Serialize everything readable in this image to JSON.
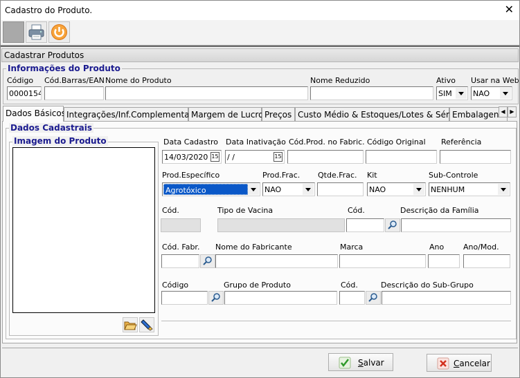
{
  "window": {
    "title": "Cadastro do Produto."
  },
  "header": {
    "title": "Cadastrar Produtos"
  },
  "info": {
    "legend": "Informações do Produto",
    "codigo_label": "Código",
    "codigo_value": "0000154",
    "barras_label": "Cód.Barras/EAN",
    "barras_value": "",
    "nome_label": "Nome do Produto",
    "nome_value": "",
    "reduzido_label": "Nome Reduzido",
    "reduzido_value": "",
    "ativo_label": "Ativo",
    "ativo_value": "SIM",
    "web_label": "Usar na Web",
    "web_value": "NAO"
  },
  "tabs": [
    {
      "label": "Dados Básicos"
    },
    {
      "label": "Integrações/Inf.Complementar"
    },
    {
      "label": "Margem de Lucro"
    },
    {
      "label": "Preços"
    },
    {
      "label": "Custo Médio & Estoques/Lotes & Série"
    },
    {
      "label": "Embalagen"
    }
  ],
  "dados": {
    "legend": "Dados Cadastrais",
    "imagem_legend": "Imagem do Produto",
    "data_cadastro_label": "Data Cadastro",
    "data_cadastro_value": "14/03/2020",
    "data_inativacao_label": "Data Inativação",
    "data_inativacao_value": " / /",
    "cod_fabric_label": "Cód.Prod. no Fabric.",
    "cod_original_label": "Código Original",
    "referencia_label": "Referência",
    "prod_especifico_label": "Prod.Específico",
    "prod_especifico_value": "Agrotóxico",
    "prod_frac_label": "Prod.Frac.",
    "prod_frac_value": "NAO",
    "qtde_frac_label": "Qtde.Frac.",
    "kit_label": "Kit",
    "kit_value": "NAO",
    "subcontrole_label": "Sub-Controle",
    "subcontrole_value": "NENHUM",
    "cod_vacina_label": "Cód.",
    "tipo_vacina_label": "Tipo de Vacina",
    "cod_familia_label": "Cód.",
    "desc_familia_label": "Descrição da Família",
    "cod_fabr_label": "Cód. Fabr.",
    "nome_fabricante_label": "Nome do Fabricante",
    "marca_label": "Marca",
    "ano_label": "Ano",
    "ano_mod_label": "Ano/Mod.",
    "codigo_grupo_label": "Código",
    "grupo_label": "Grupo de Produto",
    "cod_subgrupo_label": "Cód.",
    "desc_subgrupo_label": "Descrição do Sub-Grupo"
  },
  "buttons": {
    "salvar_first": "S",
    "salvar_rest": "alvar",
    "cancelar_first": "C",
    "cancelar_rest": "ancelar"
  },
  "icons": {
    "toolbar": [
      "blank-icon",
      "printer-icon",
      "power-icon"
    ],
    "tabs_nav": [
      "chevron-left-icon",
      "chevron-right-icon"
    ]
  }
}
